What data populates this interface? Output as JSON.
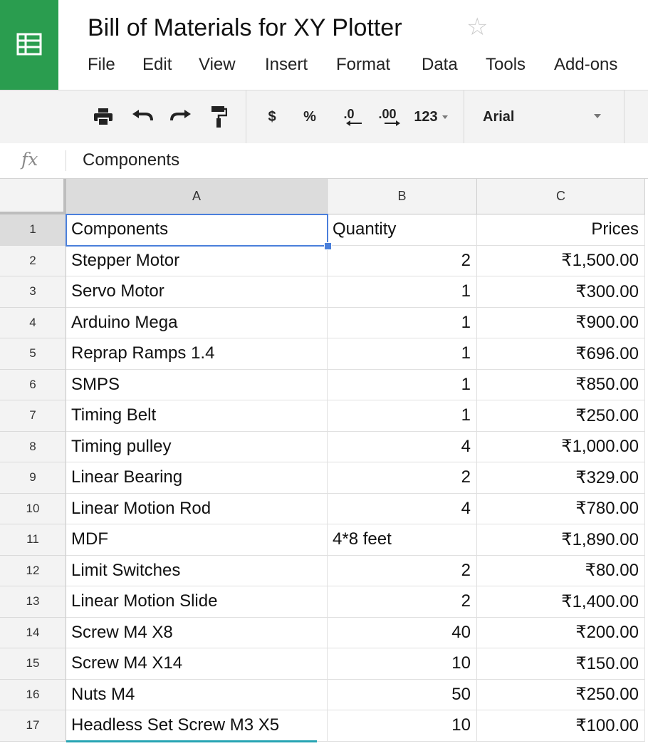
{
  "app": {
    "title": "Bill of Materials for XY Plotter",
    "menu": [
      "File",
      "Edit",
      "View",
      "Insert",
      "Format",
      "Data",
      "Tools",
      "Add-ons"
    ]
  },
  "toolbar": {
    "currency_label": "$",
    "percent_label": "%",
    "decrease_decimals_label": ".0",
    "increase_decimals_label": ".00",
    "number_format_label": "123",
    "font_name": "Arial"
  },
  "formula_bar": {
    "fx_label": "fx",
    "value": "Components"
  },
  "sheet": {
    "columns": [
      "A",
      "B",
      "C"
    ],
    "rows": [
      {
        "num": "1",
        "a": "Components",
        "b": "Quantity",
        "c": "Prices"
      },
      {
        "num": "2",
        "a": "Stepper Motor",
        "b": "2",
        "c": "₹1,500.00"
      },
      {
        "num": "3",
        "a": "Servo Motor",
        "b": "1",
        "c": "₹300.00"
      },
      {
        "num": "4",
        "a": "Arduino Mega",
        "b": "1",
        "c": "₹900.00"
      },
      {
        "num": "5",
        "a": "Reprap Ramps 1.4",
        "b": "1",
        "c": "₹696.00"
      },
      {
        "num": "6",
        "a": "SMPS",
        "b": "1",
        "c": "₹850.00"
      },
      {
        "num": "7",
        "a": "Timing Belt",
        "b": "1",
        "c": "₹250.00"
      },
      {
        "num": "8",
        "a": "Timing pulley",
        "b": "4",
        "c": "₹1,000.00"
      },
      {
        "num": "9",
        "a": "Linear Bearing",
        "b": "2",
        "c": "₹329.00"
      },
      {
        "num": "10",
        "a": "Linear Motion Rod",
        "b": "4",
        "c": "₹780.00"
      },
      {
        "num": "11",
        "a": "MDF",
        "b": "4*8 feet",
        "c": "₹1,890.00"
      },
      {
        "num": "12",
        "a": "Limit Switches",
        "b": "2",
        "c": "₹80.00"
      },
      {
        "num": "13",
        "a": "Linear Motion Slide",
        "b": "2",
        "c": "₹1,400.00"
      },
      {
        "num": "14",
        "a": "Screw M4 X8",
        "b": "40",
        "c": "₹200.00"
      },
      {
        "num": "15",
        "a": "Screw M4 X14",
        "b": "10",
        "c": "₹150.00"
      },
      {
        "num": "16",
        "a": "Nuts M4",
        "b": "50",
        "c": "₹250.00"
      },
      {
        "num": "17",
        "a": "Headless Set Screw M3 X5",
        "b": "10",
        "c": "₹100.00"
      }
    ]
  },
  "colors": {
    "brand_green": "#2a9d4f",
    "selection_blue": "#4a7fdb"
  }
}
